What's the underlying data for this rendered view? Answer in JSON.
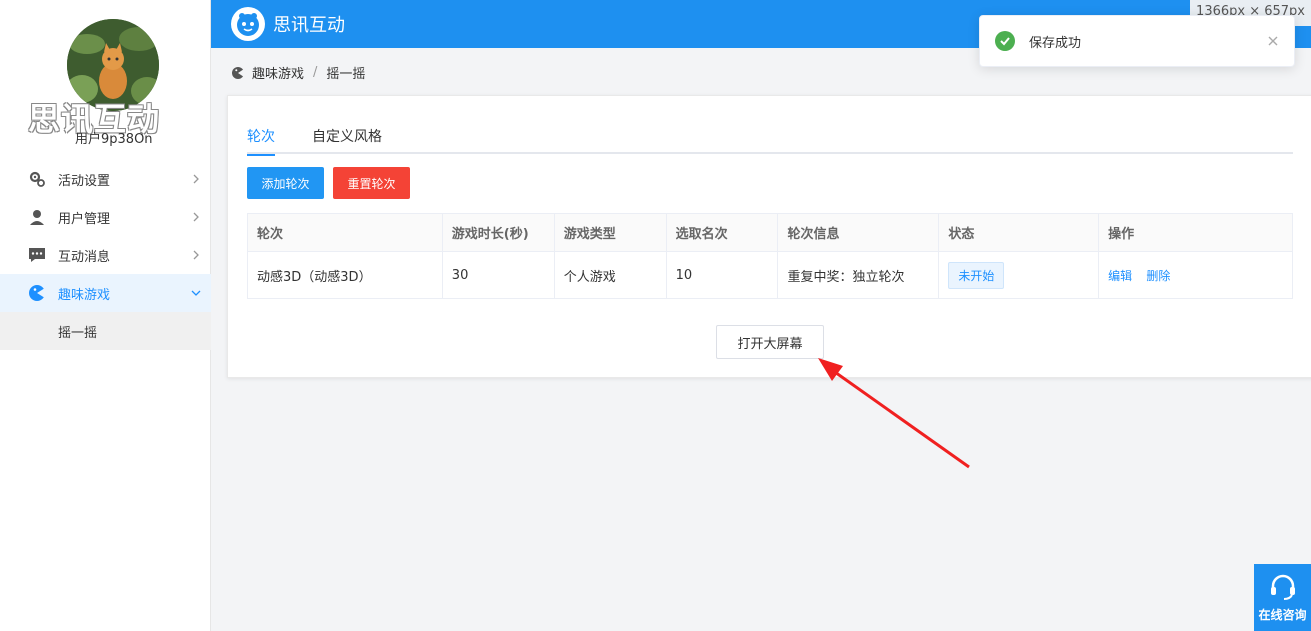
{
  "app": {
    "brand": "思讯互动",
    "size_badge": "1366px × 657px"
  },
  "user": {
    "watermark": "思讯互动",
    "name": "用户9p38On"
  },
  "sidebar": {
    "items": [
      {
        "label": "活动设置",
        "icon": "gears-icon"
      },
      {
        "label": "用户管理",
        "icon": "user-icon"
      },
      {
        "label": "互动消息",
        "icon": "message-icon"
      },
      {
        "label": "趣味游戏",
        "icon": "game-icon",
        "active": true
      }
    ],
    "sub_items": [
      {
        "label": "摇一摇"
      }
    ]
  },
  "breadcrumb": {
    "parent": "趣味游戏",
    "separator": "/",
    "current": "摇一摇"
  },
  "tabs": [
    {
      "label": "轮次",
      "active": true
    },
    {
      "label": "自定义风格"
    }
  ],
  "buttons": {
    "add_round": "添加轮次",
    "reset_round": "重置轮次",
    "open_screen": "打开大屏幕"
  },
  "table": {
    "headers": [
      "轮次",
      "游戏时长(秒)",
      "游戏类型",
      "选取名次",
      "轮次信息",
      "状态",
      "操作"
    ],
    "rows": [
      {
        "round": "动感3D（动感3D）",
        "duration": "30",
        "type": "个人游戏",
        "rank": "10",
        "info": "重复中奖：独立轮次",
        "status": "未开始",
        "edit": "编辑",
        "delete": "删除"
      }
    ]
  },
  "toast": {
    "message": "保存成功"
  },
  "consult": {
    "label": "在线咨询"
  },
  "colors": {
    "primary": "#1e90f0",
    "danger": "#f44336",
    "success": "#4caf50",
    "annotation_arrow": "#f02020"
  }
}
